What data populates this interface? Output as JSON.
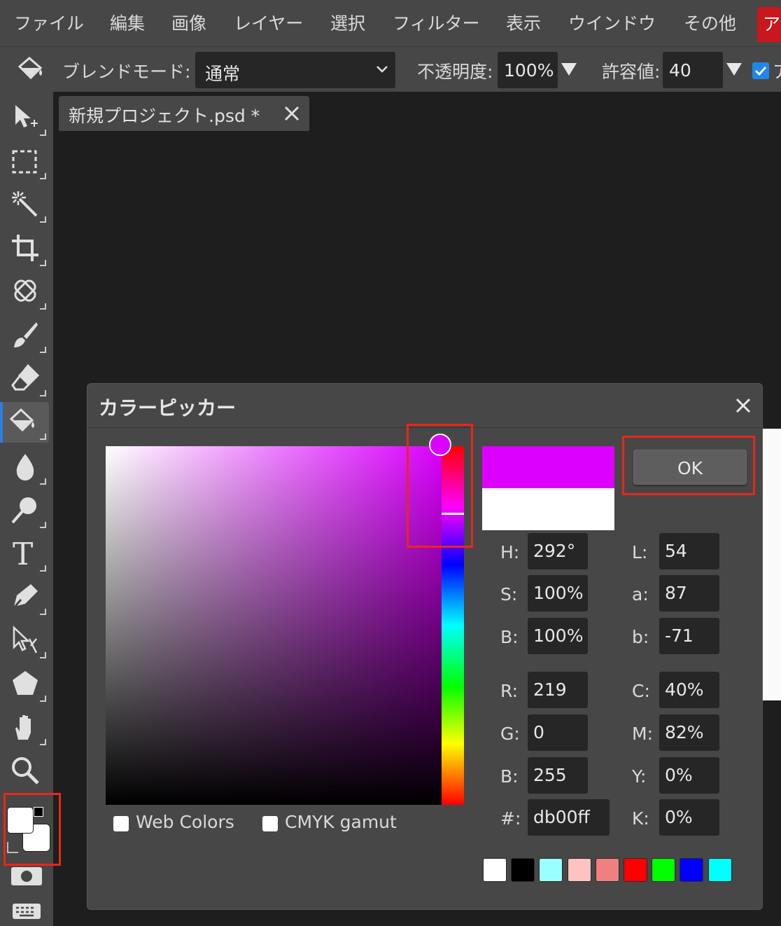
{
  "menubar": {
    "items": [
      "ファイル",
      "編集",
      "画像",
      "レイヤー",
      "選択",
      "フィルター",
      "表示",
      "ウインドウ",
      "その他"
    ],
    "account_label": "ア"
  },
  "options": {
    "blend_label": "ブレンドモード:",
    "blend_value": "通常",
    "opacity_label": "不透明度:",
    "opacity_value": "100%",
    "tolerance_label": "許容値:",
    "tolerance_value": "40",
    "overflow_label": "ア"
  },
  "document": {
    "tab_title": "新規プロジェクト.psd *"
  },
  "tools": [
    "move-tool",
    "marquee-tool",
    "magic-wand-tool",
    "crop-tool",
    "healing-tool",
    "brush-tool",
    "eraser-tool",
    "paint-bucket-tool",
    "blur-tool",
    "smudge-tool",
    "text-tool",
    "pen-tool",
    "path-select-tool",
    "shape-tool",
    "hand-tool",
    "zoom-tool"
  ],
  "active_tool": "paint-bucket-tool",
  "color_picker": {
    "title": "カラーピッカー",
    "ok_label": "OK",
    "new_color": "#db00ff",
    "old_color": "#ffffff",
    "fields": {
      "H": "292°",
      "S": "100%",
      "B": "100%",
      "R": "219",
      "G": "0",
      "B2": "255",
      "hex": "db00ff",
      "L": "54",
      "a": "87",
      "b": "-71",
      "C": "40%",
      "M": "82%",
      "Y": "0%",
      "K": "0%"
    },
    "labels": {
      "H": "H:",
      "S": "S:",
      "B": "B:",
      "R": "R:",
      "G": "G:",
      "B2": "B:",
      "hex": "#:",
      "L": "L:",
      "a": "a:",
      "b": "b:",
      "C": "C:",
      "M": "M:",
      "Y": "Y:",
      "K": "K:"
    },
    "web_colors_label": "Web Colors",
    "cmyk_label": "CMYK gamut",
    "palette": [
      "#ffffff",
      "#000000",
      "#99ffff",
      "#ffc2c2",
      "#f08080",
      "#ff0000",
      "#00ff00",
      "#0000ff",
      "#00ffff"
    ]
  },
  "colors": {
    "accent_red": "#e8271c",
    "active_blue": "#2f7de0",
    "foreground": "#ffffff",
    "background": "#ffffff"
  }
}
